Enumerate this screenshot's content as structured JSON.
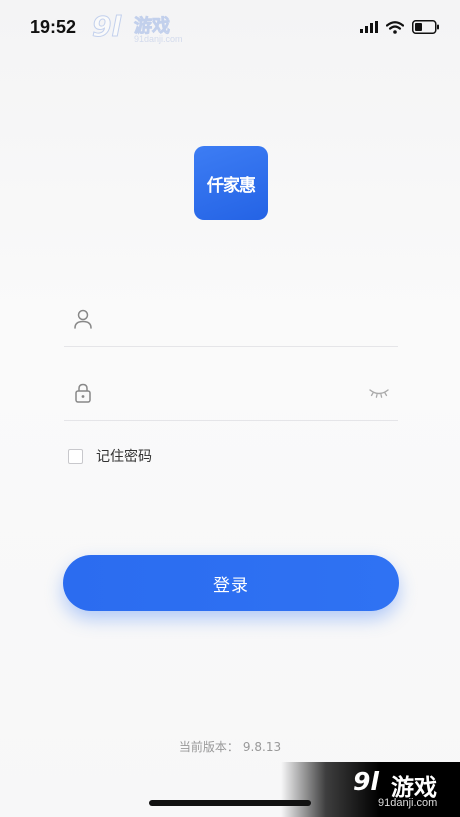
{
  "status_bar": {
    "time": "19:52",
    "icons": [
      "signal-icon",
      "wifi-icon",
      "battery-icon"
    ]
  },
  "watermark": {
    "logo": "9l",
    "brand": "游戏",
    "domain": "91danji.com"
  },
  "app": {
    "logo_text": "仟家惠",
    "logo_color": "#2F6CEB"
  },
  "login_form": {
    "username": {
      "value": "",
      "placeholder": "",
      "icon": "user-icon"
    },
    "password": {
      "value": "",
      "placeholder": "",
      "icon": "lock-icon",
      "visibility_icon": "eye-closed-icon"
    },
    "remember": {
      "label": "记住密码",
      "checked": false
    },
    "submit_label": "登录"
  },
  "footer": {
    "version_label": "当前版本：",
    "version_number": "9.8.13"
  },
  "colors": {
    "accent": "#2F72F3",
    "background": "#F7F7F8",
    "divider": "#E5E5E8",
    "muted_text": "#999999"
  }
}
